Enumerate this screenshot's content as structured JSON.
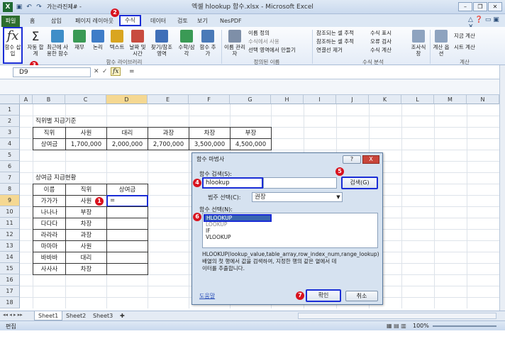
{
  "window": {
    "title": "엑셀 hlookup 함수.xlsx - Microsoft Excel",
    "quick_access": "가는라진제# -"
  },
  "tabs": [
    "파일",
    "홈",
    "삽입",
    "페이지 레이아웃",
    "수식",
    "데이터",
    "검토",
    "보기",
    "NesPDF"
  ],
  "ribbon": {
    "insert_function": "함수 삽입",
    "insert_function_glyph": "fx",
    "library": [
      {
        "label": "자동 합계"
      },
      {
        "label": "최근에 사용한 함수"
      },
      {
        "label": "재무"
      },
      {
        "label": "논리"
      },
      {
        "label": "텍스트"
      },
      {
        "label": "날짜 및 시간"
      },
      {
        "label": "찾기/참조 영역"
      },
      {
        "label": "수학/삼각"
      },
      {
        "label": "함수 추가"
      }
    ],
    "library_group": "함수 라이브러리",
    "names": {
      "manager": "이름 관리자",
      "define": "이름 정의",
      "use_in_formula": "수식에서 사용",
      "create_from_sel": "선택 영역에서 만들기",
      "group": "정의된 이름"
    },
    "audit": {
      "trace_precedents": "참조되는 셀 추적",
      "trace_dependents": "참조하는 셀 추적",
      "remove_arrows": "연결선 제거",
      "show_formulas": "수식 표시",
      "error_check": "오류 검사",
      "evaluate": "수식 계산",
      "watch": "조사식 창",
      "group": "수식 분석"
    },
    "calc": {
      "options": "계산 옵션",
      "calc_now": "지금 계산",
      "calc_sheet": "시트 계산",
      "group": "계산"
    }
  },
  "formula_bar": {
    "name_box": "D9",
    "x": "✕",
    "check": "✓",
    "fx": "fx",
    "eq": "="
  },
  "columns": [
    "A",
    "B",
    "C",
    "D",
    "E",
    "F",
    "G",
    "H",
    "I",
    "J",
    "K",
    "L",
    "M",
    "N"
  ],
  "rows": [
    "1",
    "2",
    "3",
    "4",
    "5",
    "6",
    "7",
    "8",
    "9",
    "10",
    "11",
    "12",
    "13",
    "14",
    "15",
    "16",
    "17",
    "18"
  ],
  "sheet": {
    "t1_title": "직위별 지급기준",
    "t1_header": [
      "직위",
      "사원",
      "대리",
      "과장",
      "차장",
      "부장"
    ],
    "t1_row": [
      "상여금",
      "1,700,000",
      "2,000,000",
      "2,700,000",
      "3,500,000",
      "4,500,000"
    ],
    "t2_title": "상여금 지급현황",
    "t2_header": [
      "이름",
      "직위",
      "상여금"
    ],
    "t2_rows": [
      [
        "가가가",
        "사원",
        "="
      ],
      [
        "나나나",
        "부장",
        ""
      ],
      [
        "다다다",
        "차장",
        ""
      ],
      [
        "라라라",
        "과장",
        ""
      ],
      [
        "마마마",
        "사원",
        ""
      ],
      [
        "바바바",
        "대리",
        ""
      ],
      [
        "사사사",
        "차장",
        ""
      ]
    ]
  },
  "sheet_tabs": [
    "Sheet1",
    "Sheet2",
    "Sheet3"
  ],
  "status": {
    "mode": "편집",
    "zoom": "100%"
  },
  "dialog": {
    "title": "함수 마법사",
    "help_btn": "?",
    "close_btn": "X",
    "search_label": "함수 검색(S):",
    "search_value": "hlookup",
    "search_btn": "검색(G)",
    "category_label": "범주 선택(C):",
    "category_value": "권장",
    "list_label": "함수 선택(N):",
    "functions": [
      "HLOOKUP",
      "LOOKUP",
      "IF",
      "VLOOKUP"
    ],
    "signature": "HLOOKUP(lookup_value,table_array,row_index_num,range_lookup)",
    "description": "배열의 첫 행에서 값을 검색하여, 지정한 행의 같은 열에서 데이터를 추출합니다.",
    "help_link": "도움말",
    "ok": "확인",
    "cancel": "취소"
  },
  "badges": [
    "1",
    "2",
    "3",
    "4",
    "5",
    "6",
    "7"
  ],
  "colors": {
    "highlight": "#1a2dd6",
    "badge": "#d8121e",
    "file_tab": "#2e6e2e"
  }
}
